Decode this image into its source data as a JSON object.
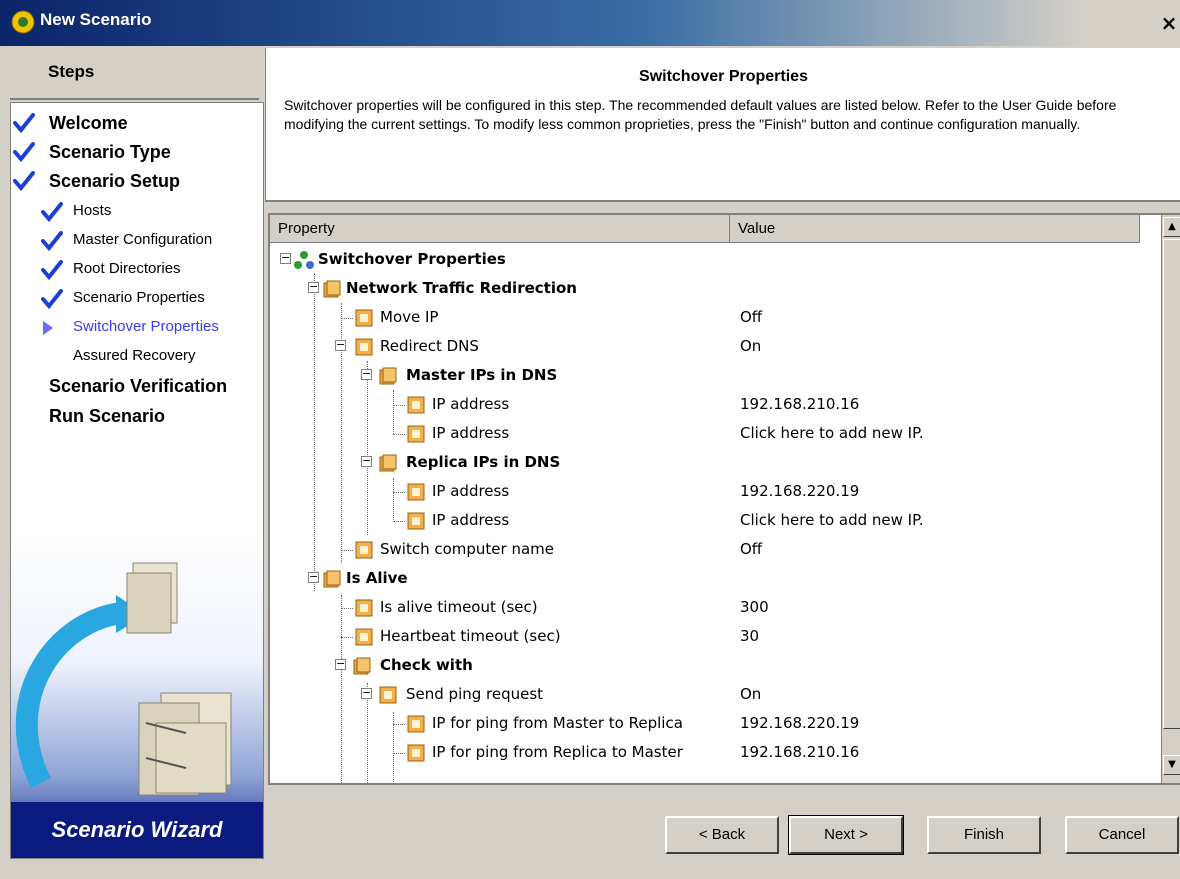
{
  "window": {
    "title": "New Scenario",
    "close_label": "×"
  },
  "steps": {
    "header": "Steps",
    "items": [
      {
        "label": "Welcome",
        "level": "top",
        "done": true
      },
      {
        "label": "Scenario Type",
        "level": "top",
        "done": true
      },
      {
        "label": "Scenario Setup",
        "level": "top",
        "done": true
      },
      {
        "label": "Hosts",
        "level": "sub",
        "done": true
      },
      {
        "label": "Master Configuration",
        "level": "sub",
        "done": true
      },
      {
        "label": "Root Directories",
        "level": "sub",
        "done": true
      },
      {
        "label": "Scenario Properties",
        "level": "sub",
        "done": true
      },
      {
        "label": "Switchover Properties",
        "level": "sub",
        "current": true
      },
      {
        "label": "Assured Recovery",
        "level": "sub",
        "done": false
      },
      {
        "label": "Scenario Verification",
        "level": "top",
        "done": false
      },
      {
        "label": "Run Scenario",
        "level": "top",
        "done": false
      }
    ],
    "wizard_label": "Scenario Wizard"
  },
  "header": {
    "title": "Switchover Properties",
    "description": "Switchover properties will be configured in this step. The recommended default values are listed below. Refer to the User Guide before modifying the current settings. To modify less common proprieties, press the \"Finish\" button and continue configuration manually."
  },
  "grid": {
    "columns": {
      "property": "Property",
      "value": "Value"
    },
    "rows": [
      {
        "label": "Switchover Properties",
        "value": "",
        "bold": true
      },
      {
        "label": "Network Traffic Redirection",
        "value": "",
        "bold": true
      },
      {
        "label": "Move IP",
        "value": "Off"
      },
      {
        "label": "Redirect DNS",
        "value": "On"
      },
      {
        "label": "Master IPs in DNS",
        "value": "",
        "bold": true
      },
      {
        "label": "IP address",
        "value": "192.168.210.16"
      },
      {
        "label": "IP address",
        "value": "Click here to add new IP."
      },
      {
        "label": "Replica IPs in DNS",
        "value": "",
        "bold": true
      },
      {
        "label": "IP address",
        "value": "192.168.220.19"
      },
      {
        "label": "IP address",
        "value": "Click here to add new IP."
      },
      {
        "label": "Switch computer name",
        "value": "Off"
      },
      {
        "label": "Is Alive",
        "value": "",
        "bold": true
      },
      {
        "label": "Is alive timeout (sec)",
        "value": "300"
      },
      {
        "label": "Heartbeat timeout (sec)",
        "value": "30"
      },
      {
        "label": "Check with",
        "value": "",
        "bold": true
      },
      {
        "label": "Send ping request",
        "value": "On"
      },
      {
        "label": "IP for ping from Master to Replica",
        "value": "192.168.220.19"
      },
      {
        "label": "IP for ping from Replica to Master",
        "value": "192.168.210.16"
      }
    ]
  },
  "buttons": {
    "back": "< Back",
    "next": "Next >",
    "finish": "Finish",
    "cancel": "Cancel"
  },
  "icons": {
    "check": "checkmark-icon",
    "current": "triangle-arrow-icon",
    "folder": "folder-icon",
    "property": "property-icon",
    "root": "network-icon"
  },
  "colors": {
    "title_bar": "#0a246a",
    "check": "#1a3fd6",
    "current_step": "#3a3af0",
    "wizard_band": "#0b1a7e"
  }
}
